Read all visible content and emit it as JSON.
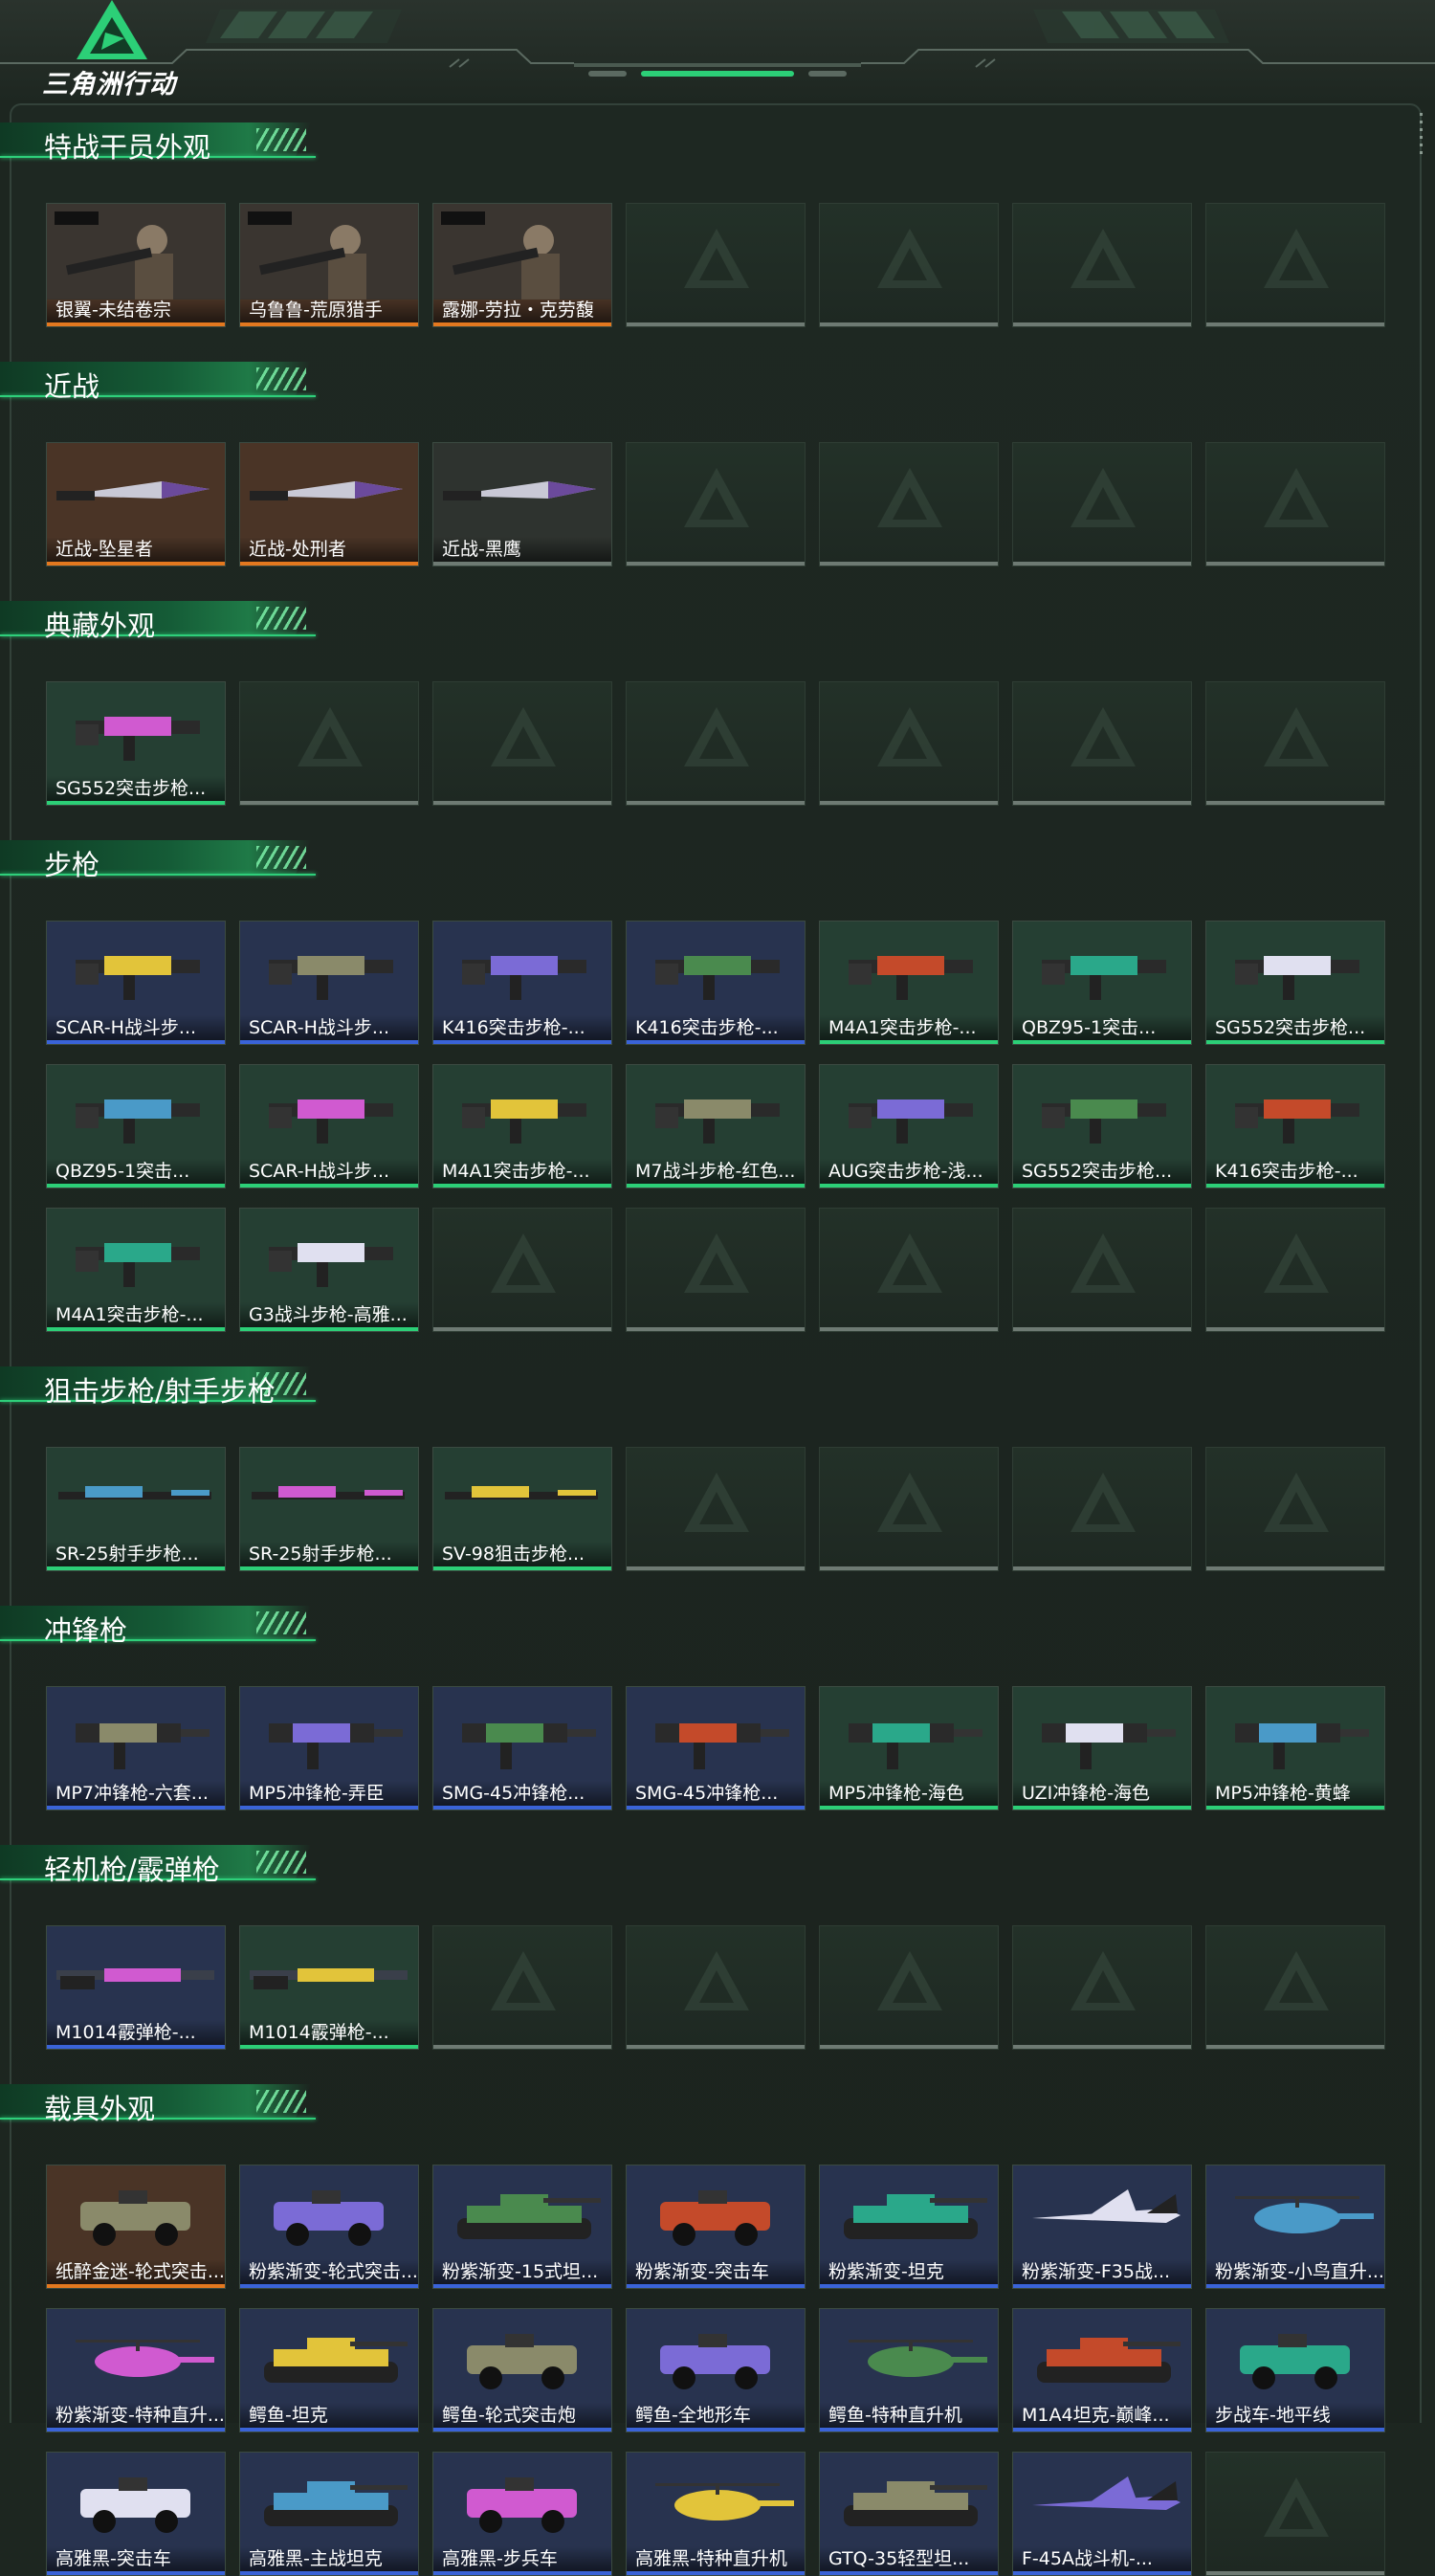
{
  "app": {
    "title": "三角洲行动"
  },
  "colors": {
    "orange": "#e3781f",
    "blue": "#3a63d8",
    "green": "#2ccf77",
    "gray": "#6e7a73",
    "purple_bg": "#3a2b52",
    "orange_bg": "#4a3426",
    "green_bg": "#253f33",
    "blue_bg": "#28334f"
  },
  "sections": [
    {
      "title": "特战干员外观",
      "rows": [
        [
          {
            "label": "银翼-未结卷宗",
            "rarity": "orange",
            "art": "operator"
          },
          {
            "label": "乌鲁鲁-荒原猎手",
            "rarity": "orange",
            "art": "operator"
          },
          {
            "label": "露娜-劳拉・克劳馥",
            "rarity": "orange",
            "art": "operator"
          },
          null,
          null,
          null,
          null
        ]
      ]
    },
    {
      "title": "近战",
      "rows": [
        [
          {
            "label": "近战-坠星者",
            "rarity": "orange",
            "art": "knife"
          },
          {
            "label": "近战-处刑者",
            "rarity": "orange",
            "art": "knife"
          },
          {
            "label": "近战-黑鹰",
            "rarity": "gray",
            "art": "knife"
          },
          null,
          null,
          null,
          null
        ]
      ]
    },
    {
      "title": "典藏外观",
      "rows": [
        [
          {
            "label": "SG552突击步枪...",
            "rarity": "green",
            "art": "rifle"
          },
          null,
          null,
          null,
          null,
          null,
          null
        ]
      ]
    },
    {
      "title": "步枪",
      "rows": [
        [
          {
            "label": "SCAR-H战斗步...",
            "rarity": "blue",
            "art": "rifle"
          },
          {
            "label": "SCAR-H战斗步...",
            "rarity": "blue",
            "art": "rifle"
          },
          {
            "label": "K416突击步枪-...",
            "rarity": "blue",
            "art": "rifle"
          },
          {
            "label": "K416突击步枪-...",
            "rarity": "blue",
            "art": "rifle"
          },
          {
            "label": "M4A1突击步枪-...",
            "rarity": "green",
            "art": "rifle"
          },
          {
            "label": "QBZ95-1突击...",
            "rarity": "green",
            "art": "rifle"
          },
          {
            "label": "SG552突击步枪...",
            "rarity": "green",
            "art": "rifle"
          }
        ],
        [
          {
            "label": "QBZ95-1突击...",
            "rarity": "green",
            "art": "rifle"
          },
          {
            "label": "SCAR-H战斗步...",
            "rarity": "green",
            "art": "rifle"
          },
          {
            "label": "M4A1突击步枪-...",
            "rarity": "green",
            "art": "rifle"
          },
          {
            "label": "M7战斗步枪-红色...",
            "rarity": "green",
            "art": "rifle"
          },
          {
            "label": "AUG突击步枪-浅...",
            "rarity": "green",
            "art": "rifle"
          },
          {
            "label": "SG552突击步枪...",
            "rarity": "green",
            "art": "rifle"
          },
          {
            "label": "K416突击步枪-...",
            "rarity": "green",
            "art": "rifle"
          }
        ],
        [
          {
            "label": "M4A1突击步枪-...",
            "rarity": "green",
            "art": "rifle"
          },
          {
            "label": "G3战斗步枪-高雅...",
            "rarity": "green",
            "art": "rifle"
          },
          null,
          null,
          null,
          null,
          null
        ]
      ]
    },
    {
      "title": "狙击步枪/射手步枪",
      "rows": [
        [
          {
            "label": "SR-25射手步枪...",
            "rarity": "green",
            "art": "sniper"
          },
          {
            "label": "SR-25射手步枪...",
            "rarity": "green",
            "art": "sniper"
          },
          {
            "label": "SV-98狙击步枪...",
            "rarity": "green",
            "art": "sniper"
          },
          null,
          null,
          null,
          null
        ]
      ]
    },
    {
      "title": "冲锋枪",
      "rows": [
        [
          {
            "label": "MP7冲锋枪-六套...",
            "rarity": "blue",
            "art": "smg"
          },
          {
            "label": "MP5冲锋枪-弄臣",
            "rarity": "blue",
            "art": "smg"
          },
          {
            "label": "SMG-45冲锋枪...",
            "rarity": "blue",
            "art": "smg"
          },
          {
            "label": "SMG-45冲锋枪...",
            "rarity": "blue",
            "art": "smg"
          },
          {
            "label": "MP5冲锋枪-海色",
            "rarity": "green",
            "art": "smg"
          },
          {
            "label": "UZI冲锋枪-海色",
            "rarity": "green",
            "art": "smg"
          },
          {
            "label": "MP5冲锋枪-黄蜂",
            "rarity": "green",
            "art": "smg"
          }
        ]
      ]
    },
    {
      "title": "轻机枪/霰弹枪",
      "rows": [
        [
          {
            "label": "M1014霰弹枪-...",
            "rarity": "blue",
            "art": "shotgun"
          },
          {
            "label": "M1014霰弹枪-...",
            "rarity": "green",
            "art": "shotgun"
          },
          null,
          null,
          null,
          null,
          null
        ]
      ]
    },
    {
      "title": "载具外观",
      "rows": [
        [
          {
            "label": "纸醉金迷-轮式突击...",
            "rarity": "orange",
            "art": "vehicle"
          },
          {
            "label": "粉紫渐变-轮式突击...",
            "rarity": "blue",
            "art": "vehicle"
          },
          {
            "label": "粉紫渐变-15式坦...",
            "rarity": "blue",
            "art": "tank"
          },
          {
            "label": "粉紫渐变-突击车",
            "rarity": "blue",
            "art": "vehicle"
          },
          {
            "label": "粉紫渐变-坦克",
            "rarity": "blue",
            "art": "tank"
          },
          {
            "label": "粉紫渐变-F35战...",
            "rarity": "blue",
            "art": "jet"
          },
          {
            "label": "粉紫渐变-小鸟直升...",
            "rarity": "blue",
            "art": "heli"
          }
        ],
        [
          {
            "label": "粉紫渐变-特种直升...",
            "rarity": "blue",
            "art": "heli"
          },
          {
            "label": "鳄鱼-坦克",
            "rarity": "blue",
            "art": "tank"
          },
          {
            "label": "鳄鱼-轮式突击炮",
            "rarity": "blue",
            "art": "vehicle"
          },
          {
            "label": "鳄鱼-全地形车",
            "rarity": "blue",
            "art": "vehicle"
          },
          {
            "label": "鳄鱼-特种直升机",
            "rarity": "blue",
            "art": "heli"
          },
          {
            "label": "M1A4坦克-巅峰...",
            "rarity": "blue",
            "art": "tank"
          },
          {
            "label": "步战车-地平线",
            "rarity": "blue",
            "art": "vehicle"
          }
        ],
        [
          {
            "label": "高雅黑-突击车",
            "rarity": "blue",
            "art": "vehicle"
          },
          {
            "label": "高雅黑-主战坦克",
            "rarity": "blue",
            "art": "tank"
          },
          {
            "label": "高雅黑-步兵车",
            "rarity": "blue",
            "art": "vehicle"
          },
          {
            "label": "高雅黑-特种直升机",
            "rarity": "blue",
            "art": "heli"
          },
          {
            "label": "GTQ-35轻型坦...",
            "rarity": "blue",
            "art": "tank"
          },
          {
            "label": "F-45A战斗机-...",
            "rarity": "blue",
            "art": "jet"
          },
          null
        ]
      ]
    }
  ]
}
